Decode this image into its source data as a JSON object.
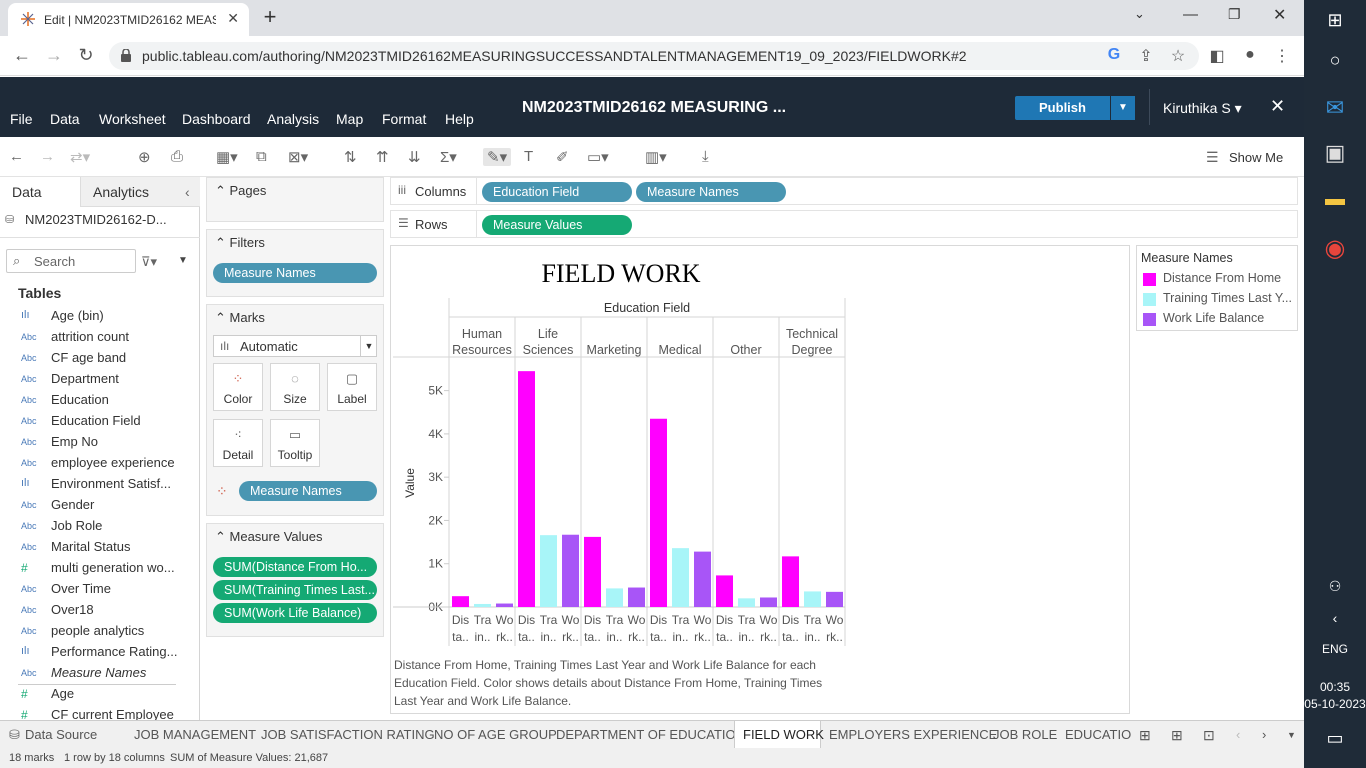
{
  "browser": {
    "tab_title": "Edit | NM2023TMID26162 MEAS",
    "url": "public.tableau.com/authoring/NM2023TMID26162MEASURINGSUCCESSANDTALENTMANAGEMENT19_09_2023/FIELDWORK#2"
  },
  "header": {
    "menus": [
      "File",
      "Data",
      "Worksheet",
      "Dashboard",
      "Analysis",
      "Map",
      "Format",
      "Help"
    ],
    "workbook_title": "NM2023TMID26162 MEASURING ...",
    "publish_label": "Publish",
    "user": "Kiruthika S ▾"
  },
  "toolbar": {
    "show_me": "Show Me"
  },
  "datapane": {
    "tab_data": "Data",
    "tab_analytics": "Analytics",
    "source": "NM2023TMID26162-D...",
    "search_placeholder": "Search",
    "tables_label": "Tables",
    "fields": [
      {
        "icon": "ılı",
        "name": "Age (bin)"
      },
      {
        "icon": "Abc",
        "name": "attrition count"
      },
      {
        "icon": "Abc",
        "name": "CF age band"
      },
      {
        "icon": "Abc",
        "name": "Department"
      },
      {
        "icon": "Abc",
        "name": "Education"
      },
      {
        "icon": "Abc",
        "name": "Education Field"
      },
      {
        "icon": "Abc",
        "name": "Emp No"
      },
      {
        "icon": "Abc",
        "name": "employee experience"
      },
      {
        "icon": "ılı",
        "name": "Environment Satisf..."
      },
      {
        "icon": "Abc",
        "name": "Gender"
      },
      {
        "icon": "Abc",
        "name": "Job Role"
      },
      {
        "icon": "Abc",
        "name": "Marital Status"
      },
      {
        "icon": "#",
        "name": "multi generation wo..."
      },
      {
        "icon": "Abc",
        "name": "Over Time"
      },
      {
        "icon": "Abc",
        "name": "Over18"
      },
      {
        "icon": "Abc",
        "name": "people analytics"
      },
      {
        "icon": "ılı",
        "name": "Performance Rating..."
      },
      {
        "icon": "Abc",
        "name": "Measure Names"
      },
      {
        "icon": "#",
        "name": "Age"
      },
      {
        "icon": "#",
        "name": "CF current Employee"
      }
    ]
  },
  "cards": {
    "pages": "Pages",
    "filters": "Filters",
    "filter_pill": "Measure Names",
    "marks": "Marks",
    "mark_type": "Automatic",
    "mark_buttons": [
      "Color",
      "Size",
      "Label",
      "Detail",
      "Tooltip"
    ],
    "color_pill": "Measure Names",
    "measure_values": "Measure Values",
    "mv_pills": [
      "SUM(Distance From Ho...",
      "SUM(Training Times Last...",
      "SUM(Work Life Balance)"
    ]
  },
  "shelves": {
    "columns_label": "Columns",
    "rows_label": "Rows",
    "columns_pills": [
      "Education Field",
      "Measure Names"
    ],
    "rows_pills": [
      "Measure Values"
    ]
  },
  "chart_data": {
    "type": "bar",
    "title": "FIELD WORK",
    "column_header": "Education Field",
    "categories": [
      "Human Resources",
      "Life Sciences",
      "Marketing",
      "Medical",
      "Other",
      "Technical Degree"
    ],
    "category_labels": [
      [
        "Human",
        "Resources"
      ],
      [
        "Life",
        "Sciences"
      ],
      [
        "",
        "Marketing"
      ],
      [
        "",
        "Medical"
      ],
      [
        "",
        "Other"
      ],
      [
        "Technical",
        "Degree"
      ]
    ],
    "sub_labels": [
      [
        "Dis",
        "ta.."
      ],
      [
        "Tra",
        "in.."
      ],
      [
        "Wo",
        "rk.."
      ]
    ],
    "ylabel": "Value",
    "ylim": [
      0,
      5800
    ],
    "yticks": [
      0,
      1000,
      2000,
      3000,
      4000,
      5000
    ],
    "ytick_labels": [
      "0K",
      "1K",
      "2K",
      "3K",
      "4K",
      "5K"
    ],
    "series": [
      {
        "name": "Distance From Home",
        "color": "#ff00ff",
        "values": [
          250,
          5450,
          1620,
          4350,
          730,
          1170
        ]
      },
      {
        "name": "Training Times Last Year",
        "color": "#a8f5f8",
        "values": [
          70,
          1660,
          430,
          1360,
          200,
          360
        ]
      },
      {
        "name": "Work Life Balance",
        "color": "#a855f7",
        "values": [
          80,
          1670,
          450,
          1280,
          220,
          350
        ]
      }
    ],
    "caption": "Distance From Home, Training Times Last Year and Work Life Balance for each Education Field.  Color shows details about Distance From Home, Training Times Last Year and Work Life Balance."
  },
  "legend": {
    "title": "Measure Names",
    "items": [
      {
        "label": "Distance From Home",
        "color": "#ff00ff"
      },
      {
        "label": "Training Times Last Y...",
        "color": "#a8f5f8"
      },
      {
        "label": "Work Life Balance",
        "color": "#a855f7"
      }
    ]
  },
  "sheet_tabs": {
    "data_source": "Data Source",
    "tabs": [
      "JOB MANAGEMENT",
      "JOB SATISFACTION RATING",
      "NO OF AGE GROUP",
      "DEPARTMENT OF EDUCATION",
      "FIELD WORK",
      "EMPLOYERS EXPERIENCE",
      "JOB ROLE",
      "EDUCATION"
    ],
    "active": "FIELD WORK"
  },
  "status": {
    "marks": "18 marks",
    "dims": "1 row by 18 columns",
    "sum": "SUM of Measure Values: 21,687"
  },
  "taskbar": {
    "lang": "ENG",
    "time": "00:35",
    "date": "05-10-2023"
  }
}
